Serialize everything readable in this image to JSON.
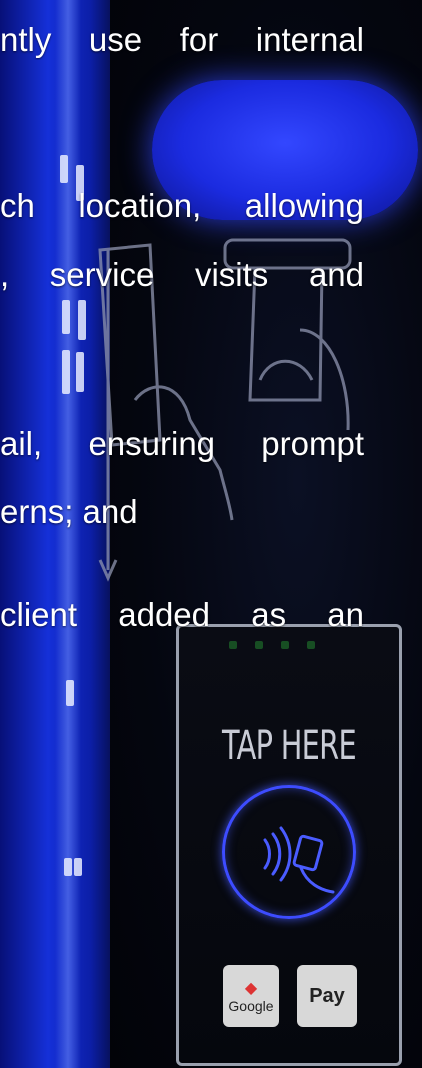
{
  "text_lines": [
    "ntly use for internal",
    "ch location, allowing",
    ", service visits and",
    "ail, ensuring prompt",
    "erns; and",
    "client added as an"
  ],
  "terminal": {
    "tap_label": "TAP HERE",
    "google_pay_label": "Google",
    "apple_pay_label": "Pay"
  },
  "colors": {
    "strip_blue": "#1530d8",
    "glow_blue": "#2438ff",
    "ring_blue": "#3d4cff"
  }
}
